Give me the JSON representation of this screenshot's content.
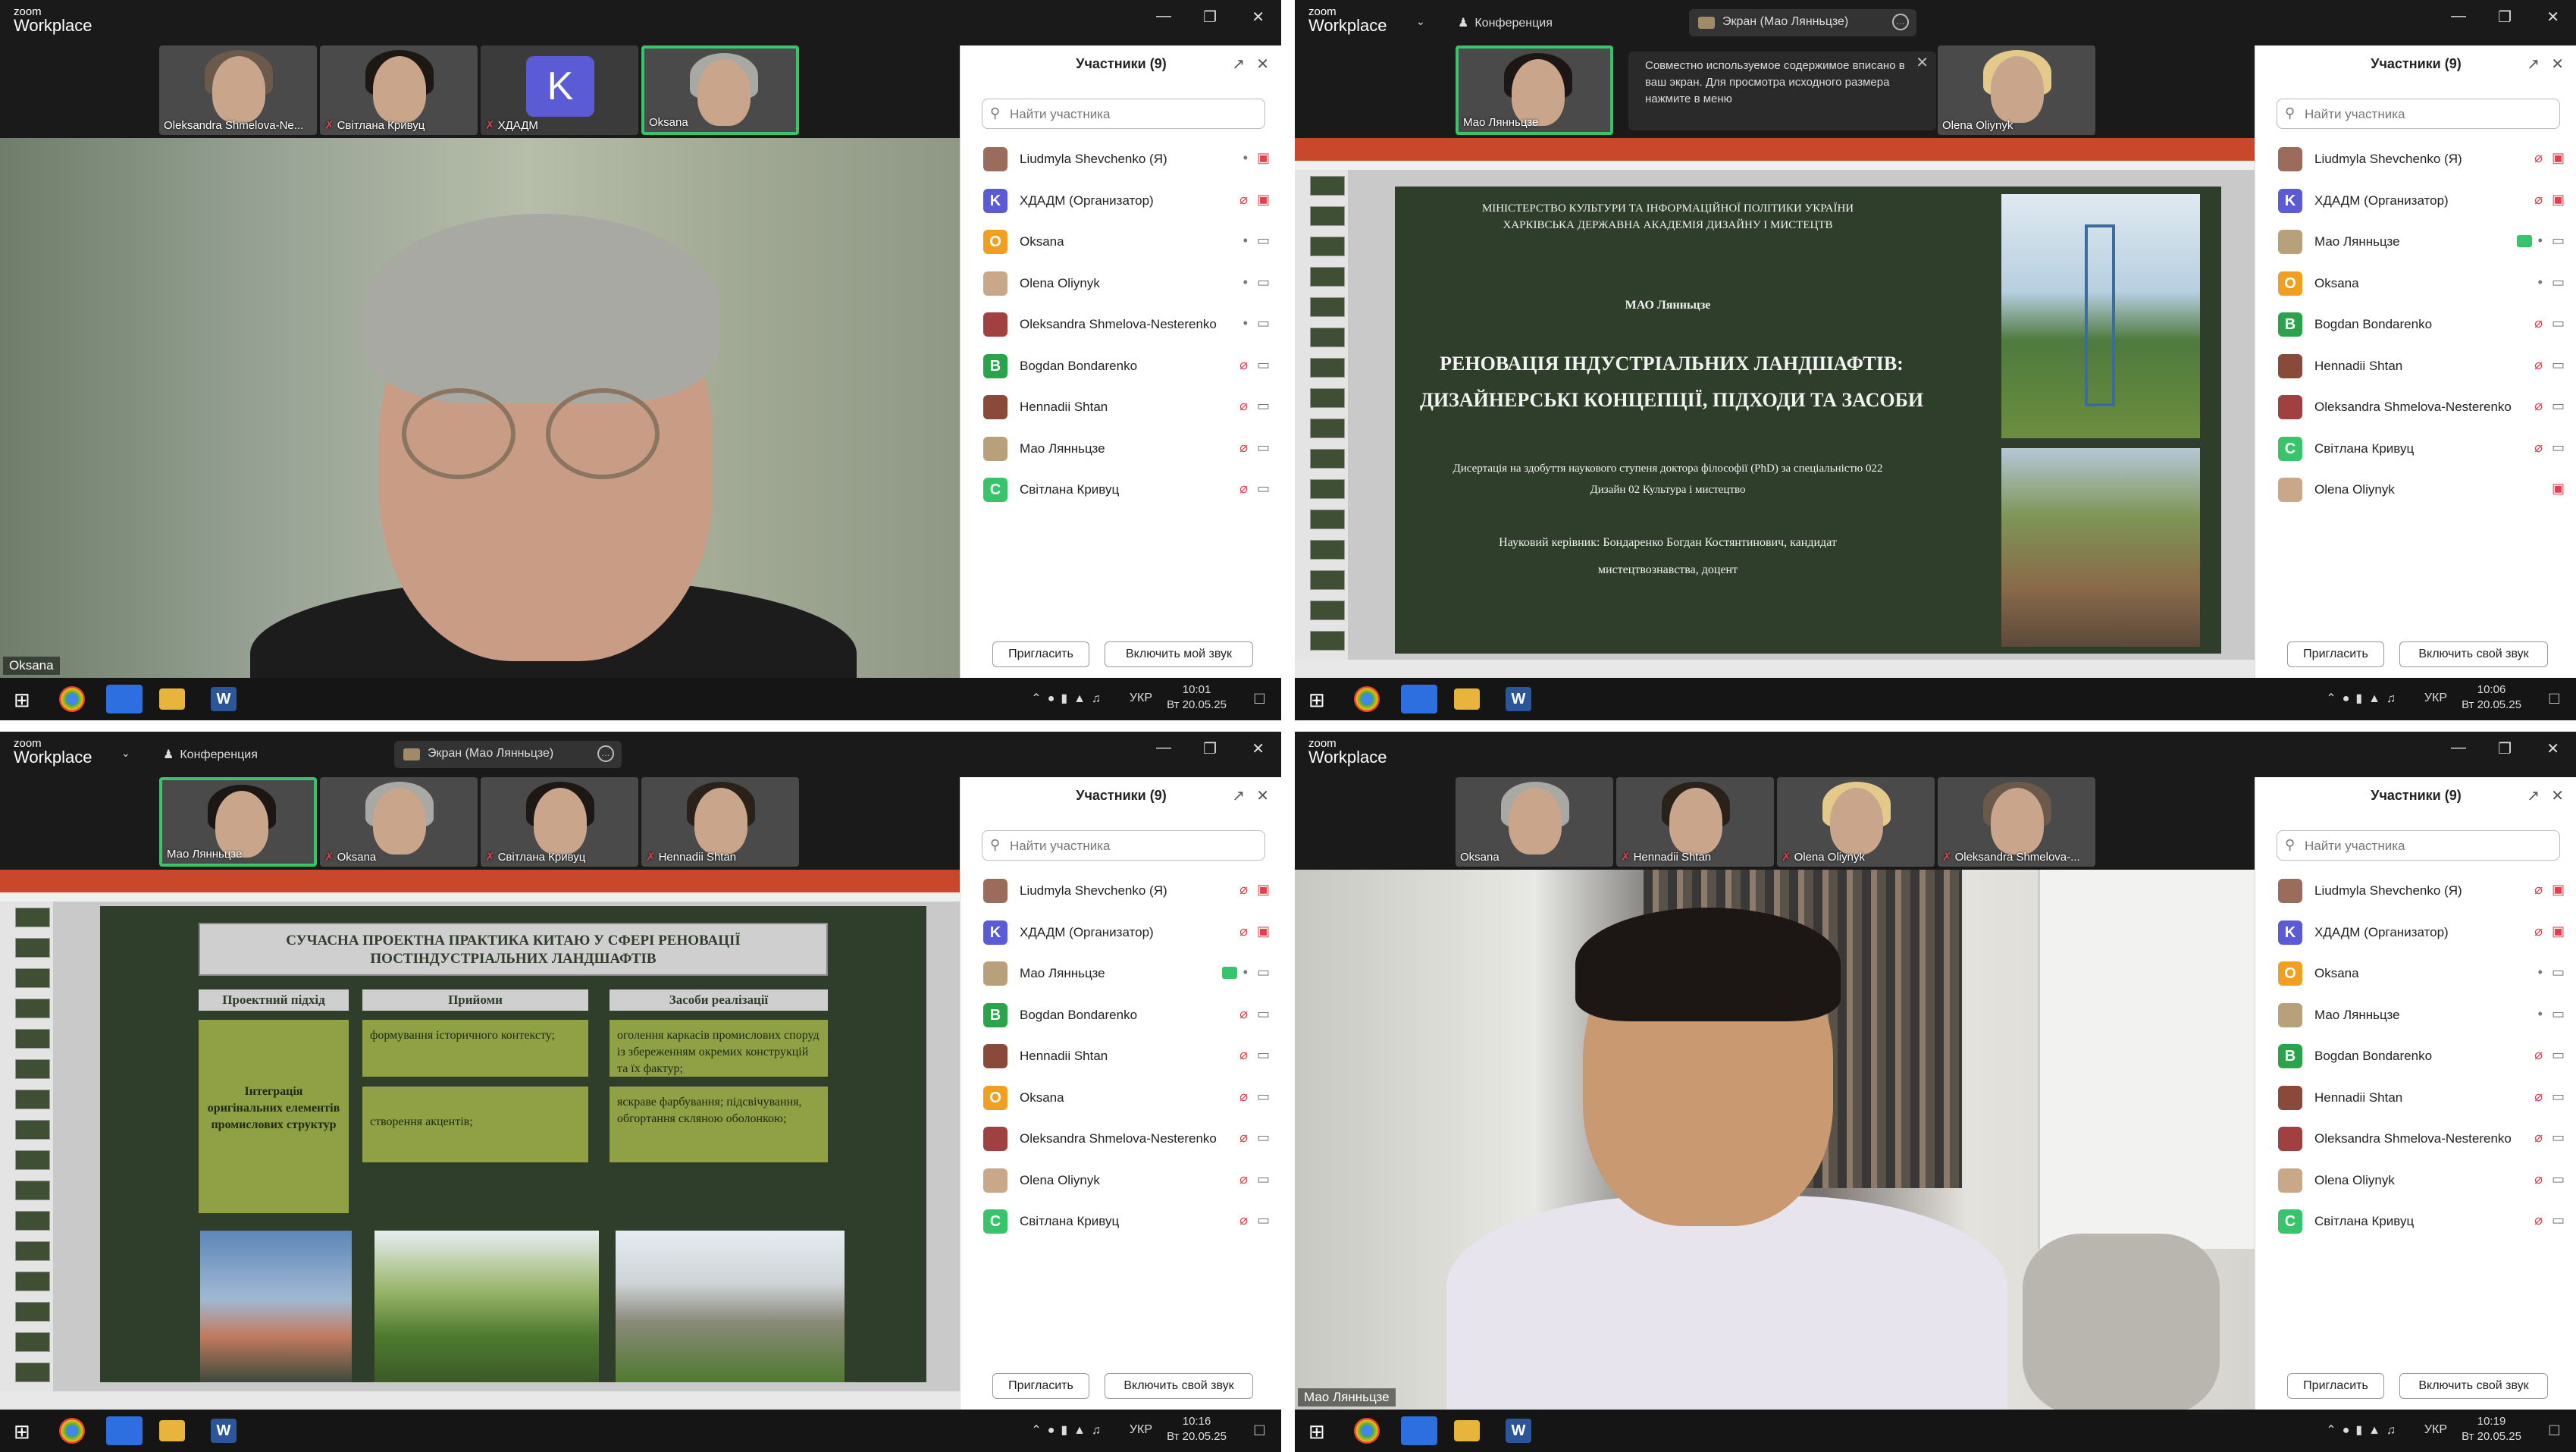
{
  "app": {
    "logo_small": "zoom",
    "logo_big": "Workplace",
    "conference": "Конференция"
  },
  "participants_panel": {
    "title": "Участники (9)",
    "search_placeholder": "Найти участника",
    "invite": "Пригласить"
  },
  "q1": {
    "thumbs": [
      "Oleksandra Shmelova-Ne...",
      "Світлана Кривуц",
      "ХДАДМ",
      "Oksana"
    ],
    "k_letter": "K",
    "main_name": "Oksana",
    "participants": [
      {
        "name": "Liudmyla Shevchenko (Я)",
        "avatar": "",
        "color": "#9b6b5b",
        "mic": "on",
        "video": "off"
      },
      {
        "name": "ХДАДМ (Организатор)",
        "avatar": "K",
        "color": "#5b5bd6",
        "mic": "muted",
        "video": "off"
      },
      {
        "name": "Oksana",
        "avatar": "O",
        "color": "#f0a020",
        "mic": "on",
        "video": "on"
      },
      {
        "name": "Olena Oliynyk",
        "avatar": "",
        "color": "#c8a888",
        "mic": "on",
        "video": "on"
      },
      {
        "name": "Oleksandra Shmelova-Nesterenko",
        "avatar": "",
        "color": "#a04040",
        "mic": "on",
        "video": "on"
      },
      {
        "name": "Bogdan Bondarenko",
        "avatar": "B",
        "color": "#2aa44a",
        "mic": "muted",
        "video": "on"
      },
      {
        "name": "Hennadii Shtan",
        "avatar": "",
        "color": "#8a4a3a",
        "mic": "muted",
        "video": "on"
      },
      {
        "name": "Мао Лянньцзе",
        "avatar": "",
        "color": "#b8a07a",
        "mic": "muted",
        "video": "on"
      },
      {
        "name": "Світлана Кривуц",
        "avatar": "C",
        "color": "#38c46a",
        "mic": "muted",
        "video": "on"
      }
    ],
    "unmute_button": "Включить мой звук",
    "clock_time": "10:01",
    "clock_date": "Вт 20.05.25",
    "lang": "УКР"
  },
  "q2": {
    "screen_pill": "Экран (Мао Лянньцзе)",
    "thumbs": [
      "Мао Лянньцзе",
      "Olena Oliynyk"
    ],
    "toast": "Совместно используемое содержимое вписано в ваш экран. Для просмотра исходного размера нажмите в меню",
    "slide": {
      "ministry": "МІНІСТЕРСТВО КУЛЬТУРИ ТА ІНФОРМАЦІЙНОЇ ПОЛІТИКИ УКРАЇНИ ХАРКІВСЬКА ДЕРЖАВНА АКАДЕМІЯ ДИЗАЙНУ І МИСТЕЦТВ",
      "author": "МАО Лянньцзе",
      "title": "РЕНОВАЦІЯ ІНДУСТРІАЛЬНИХ ЛАНДШАФТІВ: ДИЗАЙНЕРСЬКІ КОНЦЕПЦІЇ, ПІДХОДИ ТА ЗАСОБИ",
      "dissertation": "Дисертація на здобуття наукового ступеня доктора філософії (PhD) за спеціальністю 022 Дизайн 02 Культура і мистецтво",
      "supervisor": "Науковий керівник: Бондаренко Богдан Костянтинович, кандидат мистецтвознавства, доцент"
    },
    "participants": [
      {
        "name": "Liudmyla Shevchenko (Я)",
        "avatar": "",
        "color": "#9b6b5b",
        "mic": "muted",
        "video": "off"
      },
      {
        "name": "ХДАДМ (Организатор)",
        "avatar": "K",
        "color": "#5b5bd6",
        "mic": "muted",
        "video": "off"
      },
      {
        "name": "Мао Лянньцзе",
        "avatar": "",
        "color": "#b8a07a",
        "mic": "sharing",
        "video": "on"
      },
      {
        "name": "Oksana",
        "avatar": "O",
        "color": "#f0a020",
        "mic": "on",
        "video": "on"
      },
      {
        "name": "Bogdan Bondarenko",
        "avatar": "B",
        "color": "#2aa44a",
        "mic": "muted",
        "video": "on"
      },
      {
        "name": "Hennadii Shtan",
        "avatar": "",
        "color": "#8a4a3a",
        "mic": "muted",
        "video": "on"
      },
      {
        "name": "Oleksandra Shmelova-Nesterenko",
        "avatar": "",
        "color": "#a04040",
        "mic": "muted",
        "video": "on"
      },
      {
        "name": "Світлана Кривуц",
        "avatar": "C",
        "color": "#38c46a",
        "mic": "muted",
        "video": "on"
      },
      {
        "name": "Olena Oliynyk",
        "avatar": "",
        "color": "#c8a888",
        "mic": "",
        "video": "off"
      }
    ],
    "unmute_button": "Включить свой звук",
    "clock_time": "10:06",
    "clock_date": "Вт 20.05.25",
    "lang": "УКР"
  },
  "q3": {
    "screen_pill": "Экран (Мао Лянньцзе)",
    "thumbs": [
      "Мао Лянньцзе",
      "Oksana",
      "Світлана Кривуц",
      "Hennadii Shtan"
    ],
    "slide": {
      "heading": "СУЧАСНА ПРОЕКТНА ПРАКТИКА КИТАЮ У СФЕРІ РЕНОВАЦІЇ ПОСТІНДУСТРІАЛЬНИХ ЛАНДШАФТІВ",
      "col1": "Проектний підхід",
      "col2": "Прийоми",
      "col3": "Засоби реалізації",
      "approach": "Інтеграція оригінальних елементів промислових структур",
      "technique1": "формування історичного контексту;",
      "technique2": "створення акцентів;",
      "means1": "оголення каркасів промислових споруд із збереженням окремих конструкцій та їх фактур;",
      "means2": "яскраве фарбування; підсвічування, обгортання скляною оболонкою;"
    },
    "participants": [
      {
        "name": "Liudmyla Shevchenko (Я)",
        "avatar": "",
        "color": "#9b6b5b",
        "mic": "muted",
        "video": "off"
      },
      {
        "name": "ХДАДМ (Организатор)",
        "avatar": "K",
        "color": "#5b5bd6",
        "mic": "muted",
        "video": "off"
      },
      {
        "name": "Мао Лянньцзе",
        "avatar": "",
        "color": "#b8a07a",
        "mic": "sharing",
        "video": "on"
      },
      {
        "name": "Bogdan Bondarenko",
        "avatar": "B",
        "color": "#2aa44a",
        "mic": "muted",
        "video": "on"
      },
      {
        "name": "Hennadii Shtan",
        "avatar": "",
        "color": "#8a4a3a",
        "mic": "muted",
        "video": "on"
      },
      {
        "name": "Oksana",
        "avatar": "O",
        "color": "#f0a020",
        "mic": "muted",
        "video": "on"
      },
      {
        "name": "Oleksandra Shmelova-Nesterenko",
        "avatar": "",
        "color": "#a04040",
        "mic": "muted",
        "video": "on"
      },
      {
        "name": "Olena Oliynyk",
        "avatar": "",
        "color": "#c8a888",
        "mic": "muted",
        "video": "on"
      },
      {
        "name": "Світлана Кривуц",
        "avatar": "C",
        "color": "#38c46a",
        "mic": "muted",
        "video": "on"
      }
    ],
    "unmute_button": "Включить свой звук",
    "clock_time": "10:16",
    "clock_date": "Вт 20.05.25",
    "lang": "УКР"
  },
  "q4": {
    "thumbs": [
      "Oksana",
      "Hennadii Shtan",
      "Olena Oliynyk",
      "Oleksandra Shmelova-..."
    ],
    "main_name": "Мао Лянньцзе",
    "participants": [
      {
        "name": "Liudmyla Shevchenko (Я)",
        "avatar": "",
        "color": "#9b6b5b",
        "mic": "muted",
        "video": "off"
      },
      {
        "name": "ХДАДМ (Организатор)",
        "avatar": "K",
        "color": "#5b5bd6",
        "mic": "muted",
        "video": "off"
      },
      {
        "name": "Oksana",
        "avatar": "O",
        "color": "#f0a020",
        "mic": "on",
        "video": "on"
      },
      {
        "name": "Мао Лянньцзе",
        "avatar": "",
        "color": "#b8a07a",
        "mic": "on",
        "video": "on"
      },
      {
        "name": "Bogdan Bondarenko",
        "avatar": "B",
        "color": "#2aa44a",
        "mic": "muted",
        "video": "on"
      },
      {
        "name": "Hennadii Shtan",
        "avatar": "",
        "color": "#8a4a3a",
        "mic": "muted",
        "video": "on"
      },
      {
        "name": "Oleksandra Shmelova-Nesterenko",
        "avatar": "",
        "color": "#a04040",
        "mic": "muted",
        "video": "on"
      },
      {
        "name": "Olena Oliynyk",
        "avatar": "",
        "color": "#c8a888",
        "mic": "muted",
        "video": "on"
      },
      {
        "name": "Світлана Кривуц",
        "avatar": "C",
        "color": "#38c46a",
        "mic": "muted",
        "video": "on"
      }
    ],
    "unmute_button": "Включить свой звук",
    "clock_time": "10:19",
    "clock_date": "Вт 20.05.25",
    "lang": "УКР"
  }
}
